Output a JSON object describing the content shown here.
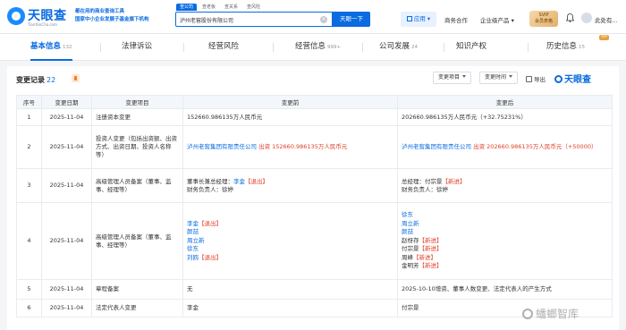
{
  "header": {
    "logo_text": "天眼查",
    "logo_sub": "TianYanCha.com",
    "slogan_line1": "都在用的商业查询工具",
    "slogan_line2": "国家中小企业发展子基金旗下机构",
    "search_tabs": [
      "查公司",
      "查老板",
      "查关系",
      "查风险"
    ],
    "search_value": "泸州老窖股份有限公司",
    "search_button": "天眼一下",
    "app_button": "应用",
    "nav_links": [
      "商务合作",
      "企业级产品"
    ],
    "svip_line1": "SVIP",
    "svip_line2": "会员表格",
    "user_name": "此处有..."
  },
  "tabs": [
    {
      "label": "基本信息",
      "count": "132"
    },
    {
      "label": "法律诉讼",
      "count": ""
    },
    {
      "label": "经营风险",
      "count": ""
    },
    {
      "label": "经营信息",
      "count": "999+"
    },
    {
      "label": "公司发展",
      "count": "24"
    },
    {
      "label": "知识产权",
      "count": ""
    },
    {
      "label": "历史信息",
      "count": "15"
    }
  ],
  "vip_badge": "VIP",
  "section": {
    "title": "变更记录",
    "count": "22",
    "filter1": "变更项目",
    "filter2": "变更时间",
    "export": "导出",
    "brand": "天眼查"
  },
  "table": {
    "headers": [
      "序号",
      "变更日期",
      "变更项目",
      "变更前",
      "变更后"
    ],
    "rows": [
      {
        "no": "1",
        "date": "2025-11-04",
        "item": "注册资本变更",
        "before": "152660.986135万人民币元",
        "after": "202660.986135万人民币元（+32.75231%）"
      },
      {
        "no": "2",
        "date": "2025-11-04",
        "item": "投资人变更（包括出资额、出资方式、出资日期、投资人名称等）",
        "before_company": "泸州老窖集团有限责任公司",
        "before_text": "出资 152660.986135万人民币元",
        "after_company": "泸州老窖集团有限责任公司",
        "after_text": "出资 202660.986135万人民币元（+50000）"
      },
      {
        "no": "3",
        "date": "2025-11-04",
        "item": "高级管理人员备案（董事、监事、经理等）",
        "before_l1": "董事长兼总经理：",
        "before_name1": "李金",
        "before_tag1": "【退出】",
        "before_l2": "财务负责人：徐婷",
        "after_l1": "总经理：付宗景",
        "after_tag1": "【新进】",
        "after_l2": "财务负责人：徐婷"
      },
      {
        "no": "4",
        "date": "2025-11-04",
        "item": "高级管理人员备案（董事、监事、经理等）",
        "before_list": [
          {
            "name": "李金",
            "tag": "【退出】"
          },
          {
            "name": "颜喆",
            "tag": ""
          },
          {
            "name": "周立新",
            "tag": ""
          },
          {
            "name": "徐东",
            "tag": ""
          },
          {
            "name": "刘鸥",
            "tag": "【退出】"
          }
        ],
        "after_list": [
          {
            "name": "徐东",
            "tag": ""
          },
          {
            "name": "周立新",
            "tag": ""
          },
          {
            "name": "颜喆",
            "tag": ""
          },
          {
            "name": "赵枒存",
            "tag": "【新进】"
          },
          {
            "name": "付宗景",
            "tag": "【新进】"
          },
          {
            "name": "周峰",
            "tag": "【新进】"
          },
          {
            "name": "金明芳",
            "tag": "【新进】"
          }
        ]
      },
      {
        "no": "5",
        "date": "2025-11-04",
        "item": "章程备案",
        "before": "无",
        "after": "2025-10-10增资、董事人数变更、法定代表人的产生方式"
      },
      {
        "no": "6",
        "date": "2025-11-04",
        "item": "法定代表人变更",
        "before": "李金",
        "after": "付宗景"
      }
    ]
  },
  "watermark": "蟠螂智库"
}
